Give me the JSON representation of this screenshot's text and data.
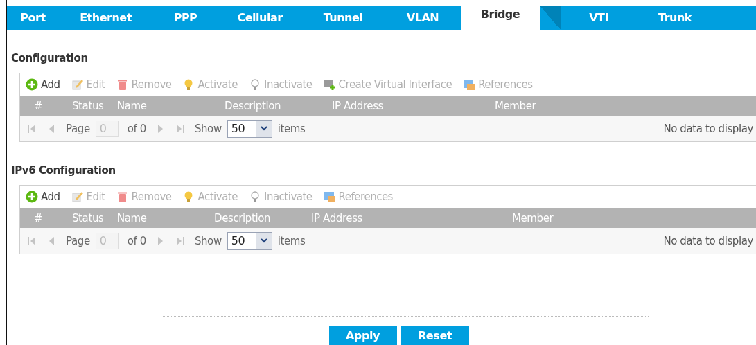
{
  "tabs": [
    {
      "label": "Port",
      "selected": false
    },
    {
      "label": "Ethernet",
      "selected": false
    },
    {
      "label": "PPP",
      "selected": false
    },
    {
      "label": "Cellular",
      "selected": false
    },
    {
      "label": "Tunnel",
      "selected": false
    },
    {
      "label": "VLAN",
      "selected": false
    },
    {
      "label": "Bridge",
      "selected": true
    },
    {
      "label": "VTI",
      "selected": false
    },
    {
      "label": "Trunk",
      "selected": false
    }
  ],
  "sections": [
    {
      "title": "Configuration",
      "toolbar": [
        {
          "kind": "add",
          "label": "Add",
          "disabled": false
        },
        {
          "kind": "edit",
          "label": "Edit",
          "disabled": true
        },
        {
          "kind": "remove",
          "label": "Remove",
          "disabled": true
        },
        {
          "kind": "activate",
          "label": "Activate",
          "disabled": true
        },
        {
          "kind": "inactivate",
          "label": "Inactivate",
          "disabled": true
        },
        {
          "kind": "virtual",
          "label": "Create Virtual Interface",
          "disabled": true
        },
        {
          "kind": "references",
          "label": "References",
          "disabled": true
        }
      ],
      "columns": [
        "#",
        "Status",
        "Name",
        "Description",
        "IP Address",
        "Member"
      ],
      "pager": {
        "page_label": "Page",
        "page": "0",
        "of": "of 0",
        "show_label": "Show",
        "show": "50",
        "items_label": "items",
        "empty": "No data to display"
      }
    },
    {
      "title": "IPv6 Configuration",
      "toolbar": [
        {
          "kind": "add",
          "label": "Add",
          "disabled": false
        },
        {
          "kind": "edit",
          "label": "Edit",
          "disabled": true
        },
        {
          "kind": "remove",
          "label": "Remove",
          "disabled": true
        },
        {
          "kind": "activate",
          "label": "Activate",
          "disabled": true
        },
        {
          "kind": "inactivate",
          "label": "Inactivate",
          "disabled": true
        },
        {
          "kind": "references",
          "label": "References",
          "disabled": true
        }
      ],
      "columns": [
        "#",
        "Status",
        "Name",
        "Description",
        "IP Address",
        "Member"
      ],
      "pager": {
        "page_label": "Page",
        "page": "0",
        "of": "of 0",
        "show_label": "Show",
        "show": "50",
        "items_label": "items",
        "empty": "No data to display"
      }
    }
  ],
  "buttons": [
    "Apply",
    "Reset"
  ]
}
